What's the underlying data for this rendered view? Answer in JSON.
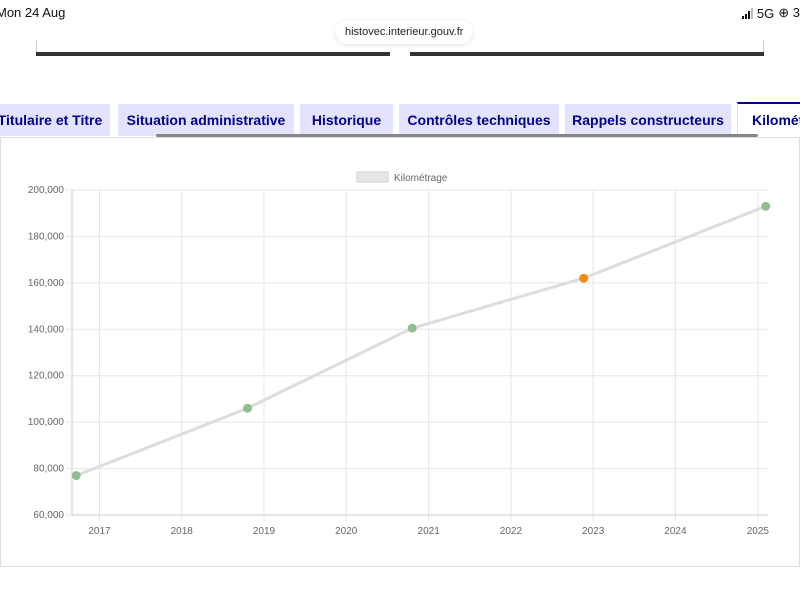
{
  "status_bar": {
    "date": "Mon 24 Aug",
    "network": "5G",
    "extra": "⊕ 3"
  },
  "browser": {
    "url": "histovec.interieur.gouv.fr"
  },
  "tabs": [
    {
      "label": "Titulaire et Titre",
      "active": false
    },
    {
      "label": "Situation administrative",
      "active": false
    },
    {
      "label": "Historique",
      "active": false
    },
    {
      "label": "Contrôles techniques",
      "active": false
    },
    {
      "label": "Rappels constructeurs",
      "active": false
    },
    {
      "label": "Kilomét",
      "active": true
    }
  ],
  "colors": {
    "tab_bg": "#e3e3fd",
    "tab_text": "#000091",
    "line": "#dddddd",
    "point_normal": "#8fbf8f",
    "point_highlight": "#f08c1a"
  },
  "chart_data": {
    "type": "line",
    "legend": [
      "Kilométrage"
    ],
    "legend_position": "top-center",
    "grid": true,
    "x_ticks": [
      "2017",
      "2018",
      "2019",
      "2020",
      "2021",
      "2022",
      "2023",
      "2024",
      "2025"
    ],
    "y_ticks": [
      "60,000",
      "80,000",
      "100,000",
      "120,000",
      "140,000",
      "160,000",
      "180,000",
      "200,000"
    ],
    "ylim": [
      60000,
      200000
    ],
    "xlim": [
      "2016-09-01",
      "2025-02-15"
    ],
    "series": [
      {
        "name": "Kilométrage",
        "points": [
          {
            "x": "2016-09-20",
            "y": 77000,
            "status": "normal"
          },
          {
            "x": "2018-10-20",
            "y": 106000,
            "status": "normal"
          },
          {
            "x": "2020-10-20",
            "y": 140500,
            "status": "normal"
          },
          {
            "x": "2022-11-20",
            "y": 162000,
            "status": "highlight"
          },
          {
            "x": "2025-02-05",
            "y": 193000,
            "status": "normal"
          }
        ]
      }
    ]
  }
}
